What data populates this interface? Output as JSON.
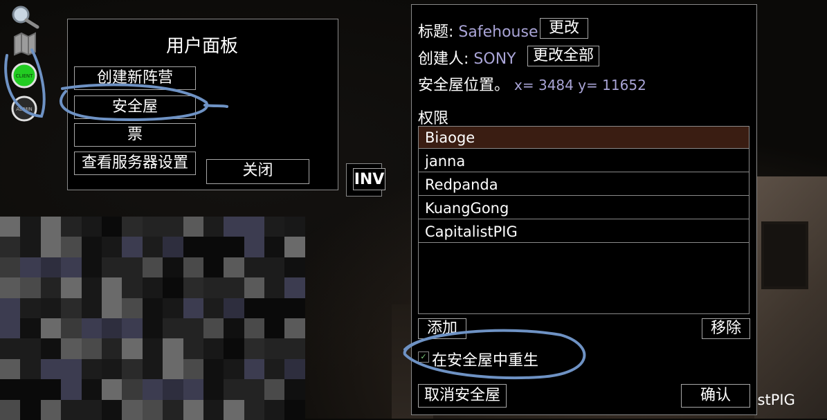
{
  "left_panel": {
    "title": "用户面板",
    "buttons": [
      "创建新阵营",
      "安全屋",
      "票",
      "查看服务器设置"
    ],
    "close_label": "关闭"
  },
  "status_icons": {
    "client_label": "CLIENT",
    "admin_label": "ADMIN"
  },
  "inv_label": "INV",
  "safehouse": {
    "title_label": "标题:",
    "title_value": "Safehouse",
    "change_label": "更改",
    "creator_label": "创建人:",
    "creator_value": "SONY",
    "change_all_label": "更改全部",
    "location_label": "安全屋位置。",
    "location_value": "x= 3484 y= 11652",
    "permissions_label": "权限",
    "members": [
      "Biaoge",
      "janna",
      "Redpanda",
      "KuangGong",
      "CapitalistPIG"
    ],
    "selected_member": "Biaoge",
    "add_label": "添加",
    "remove_label": "移除",
    "respawn_label": "在安全屋中重生",
    "respawn_checked": true,
    "cancel_label": "取消安全屋",
    "confirm_label": "确认"
  },
  "world_text": "alistPIG",
  "colors": {
    "selected_row": "#3a1d12",
    "value_text": "#a9a4d6",
    "annotation": "#6e92c4",
    "client_green": "#22cc22"
  }
}
